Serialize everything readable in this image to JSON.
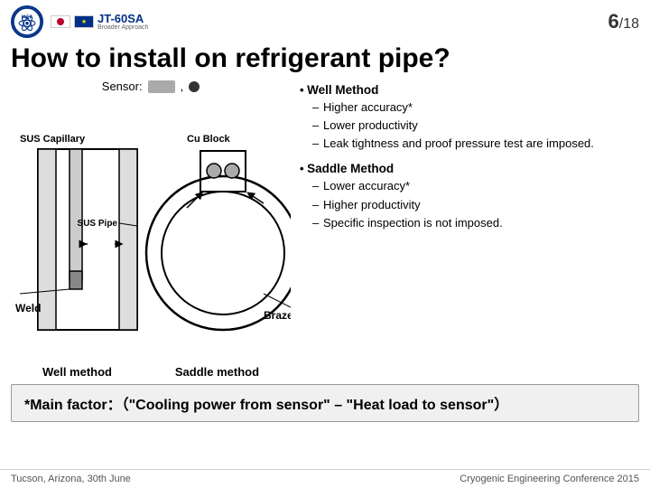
{
  "header": {
    "page_number": "6",
    "page_total": "/18",
    "logo_iaea": "IAEA",
    "logo_jt60sa": "JT-60SA"
  },
  "title": "How to install on refrigerant pipe?",
  "diagram": {
    "sensor_label": "Sensor:",
    "labels": {
      "sus_capillary": "SUS Capillary",
      "cu_block": "Cu Block",
      "sus_pipe": "SUS Pipe",
      "weld": "Weld",
      "braze": "Braze",
      "well_method": "Well method",
      "saddle_method": "Saddle method"
    }
  },
  "well_method": {
    "heading": "Well Method",
    "items": [
      "Higher accuracy*",
      "Lower productivity",
      "Leak tightness and proof pressure test are imposed."
    ]
  },
  "saddle_method": {
    "heading": "Saddle Method",
    "items": [
      "Lower accuracy*",
      "Higher productivity",
      "Specific inspection is not imposed."
    ]
  },
  "footer_note": "*Main factor：（\"Cooling power from sensor\" – \"Heat load to sensor\"）",
  "bottom": {
    "location": "Tucson, Arizona, 30th June",
    "conference": "Cryogenic Engineering Conference 2015"
  }
}
